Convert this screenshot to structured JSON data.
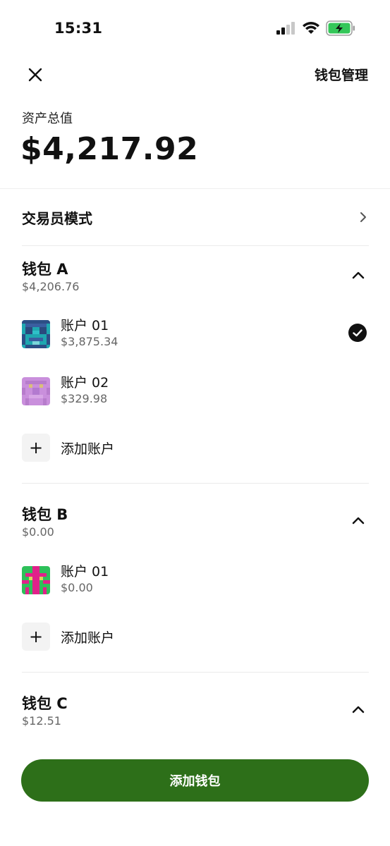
{
  "status_bar": {
    "time": "15:31",
    "icons": [
      "signal-icon",
      "wifi-icon",
      "battery-charging-icon"
    ]
  },
  "header": {
    "close_icon": "close-icon",
    "manage_label": "钱包管理"
  },
  "summary": {
    "total_label": "资产总值",
    "total_value": "$4,217.92"
  },
  "trader_mode": {
    "label": "交易员模式",
    "icon": "chevron-right-icon"
  },
  "wallets": [
    {
      "name": "钱包 A",
      "balance": "$4,206.76",
      "expanded": true,
      "accounts": [
        {
          "name": "账户 01",
          "balance": "$3,875.34",
          "selected": true
        },
        {
          "name": "账户 02",
          "balance": "$329.98",
          "selected": false
        }
      ],
      "add_account_label": "添加账户"
    },
    {
      "name": "钱包 B",
      "balance": "$0.00",
      "expanded": true,
      "accounts": [
        {
          "name": "账户 01",
          "balance": "$0.00",
          "selected": false
        }
      ],
      "add_account_label": "添加账户"
    },
    {
      "name": "钱包 C",
      "balance": "$12.51",
      "expanded": true,
      "accounts": []
    }
  ],
  "add_wallet_label": "添加钱包",
  "colors": {
    "primary_button": "#2d6f19",
    "battery_charging": "#34c759",
    "secondary_text": "#666666"
  }
}
